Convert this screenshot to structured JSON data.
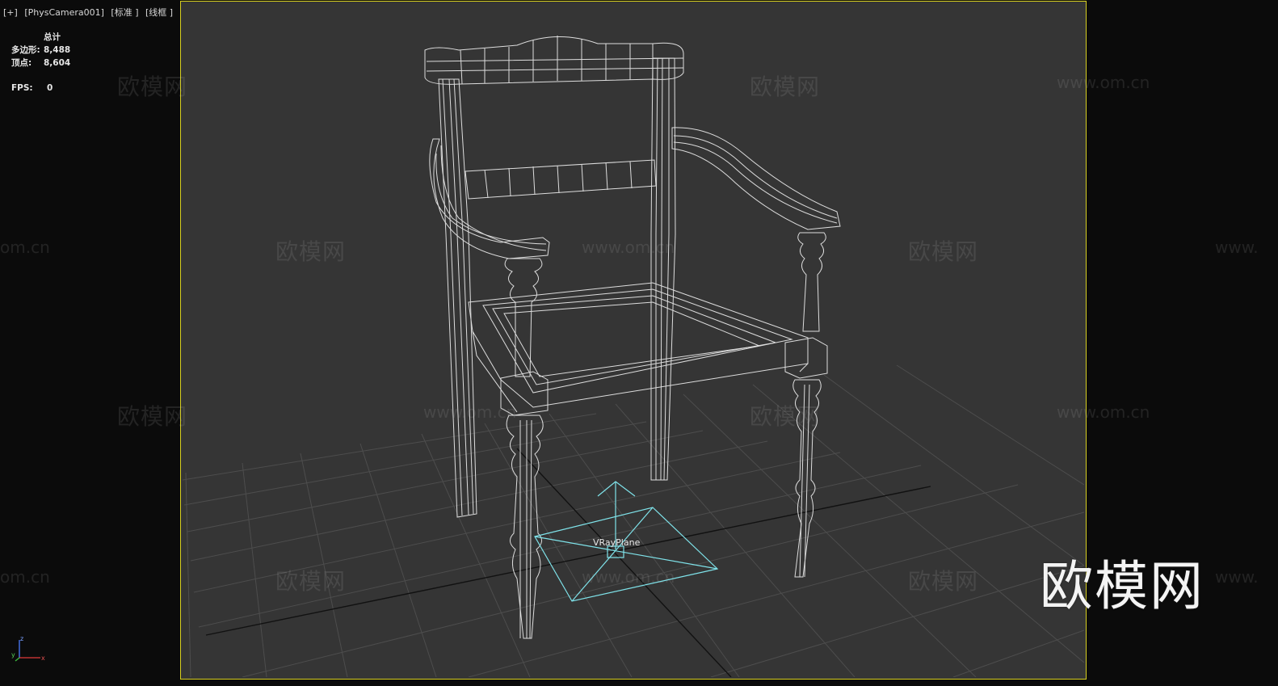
{
  "viewport": {
    "label_parts": [
      "[+]",
      "[PhysCamera001]",
      "[标准 ]",
      "[线框 ]"
    ]
  },
  "stats": {
    "header": "总计",
    "polygons_label": "多边形:",
    "polygons_value": "8,488",
    "vertices_label": "顶点:",
    "vertices_value": "8,604",
    "fps_label": "FPS:",
    "fps_value": "0"
  },
  "scene": {
    "light_name": "VRayPlane",
    "wireframe_color": "#e6e6e6",
    "light_color": "#7fe3ea",
    "grid_color": "#4a4a4a",
    "frame_color": "#d8d020",
    "background_color": "#353535"
  },
  "axis_tripod": {
    "z": "z",
    "y": "y",
    "x": "x"
  },
  "watermarks": {
    "brand_text": "欧模网",
    "url_text": "www.om.cn",
    "url_fragment_left": "om.cn",
    "url_fragment_right": "www."
  },
  "logo": {
    "text": "欧模网"
  }
}
